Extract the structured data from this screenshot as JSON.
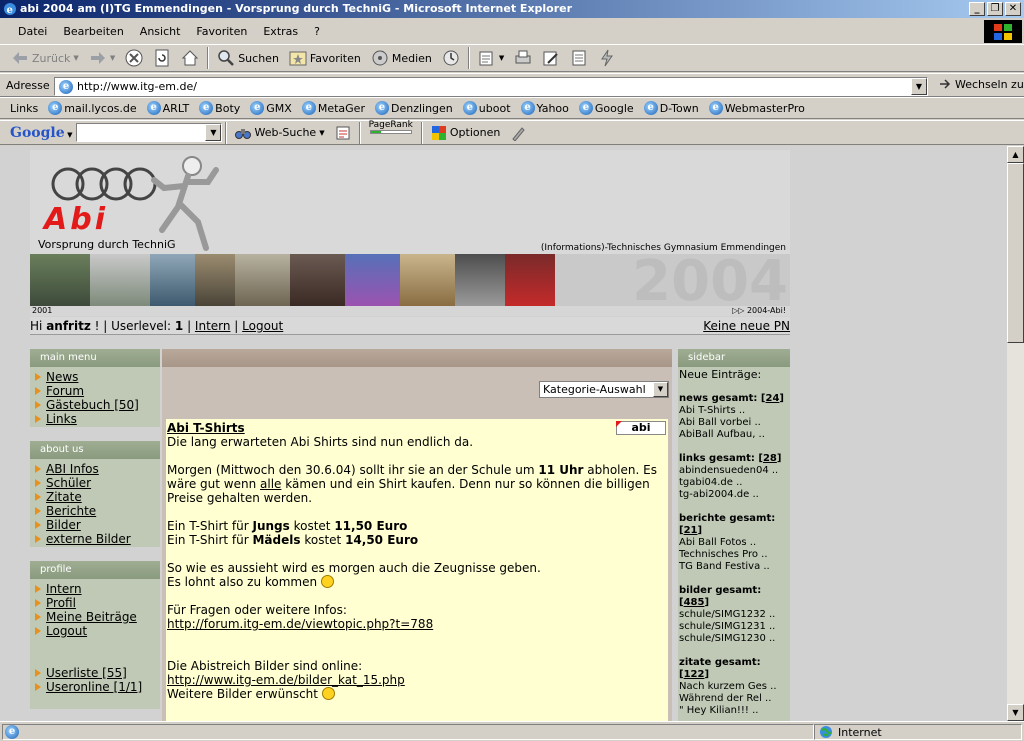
{
  "window": {
    "title": "abi 2004 am (I)TG Emmendingen - Vorsprung durch TechniG - Microsoft Internet Explorer",
    "controls": [
      "_",
      "❐",
      "✕"
    ]
  },
  "menu": [
    "Datei",
    "Bearbeiten",
    "Ansicht",
    "Favoriten",
    "Extras",
    "?"
  ],
  "toolbar": {
    "back": "Zurück",
    "search": "Suchen",
    "favorites": "Favoriten",
    "media": "Medien"
  },
  "address": {
    "label": "Adresse",
    "url": "http://www.itg-em.de/",
    "go": "Wechseln zu"
  },
  "links": {
    "label": "Links",
    "items": [
      "mail.lycos.de",
      "ARLT",
      "Boty",
      "GMX",
      "MetaGer",
      "Denzlingen",
      "uboot",
      "Yahoo",
      "Google",
      "D-Town",
      "WebmasterPro"
    ]
  },
  "googlebar": {
    "brand": "Google",
    "websearch": "Web-Suche",
    "pagerank": "PageRank",
    "options": "Optionen"
  },
  "page": {
    "banner": {
      "logo_word": "Abi",
      "slogan": "Vorsprung durch TechniG",
      "school": "(Informations)-Technisches Gymnasium Emmendingen",
      "year": "2004",
      "strip_left": "2001",
      "strip_right": "▷▷ 2004-Abi!"
    },
    "user": {
      "hi": "Hi",
      "name": "anfritz",
      "mid": "! | Userlevel:",
      "level": "1",
      "intern": "Intern",
      "logout": "Logout",
      "pn": "Keine neue PN"
    },
    "mainmenu": {
      "head": "main menu",
      "items": [
        "News",
        "Forum",
        "Gästebuch [50]",
        "Links"
      ]
    },
    "aboutus": {
      "head": "about us",
      "items": [
        "ABI Infos",
        "Schüler",
        "Zitate",
        "Berichte",
        "Bilder",
        "externe Bilder"
      ]
    },
    "profile": {
      "head": "profile",
      "items": [
        "Intern",
        "Profil",
        "Meine Beiträge",
        "Logout"
      ],
      "extra": [
        "Userliste [55]",
        "Useronline [1/1]"
      ]
    },
    "category_select": "Kategorie-Auswahl",
    "post": {
      "title": "Abi T-Shirts",
      "tag": "abi",
      "p1": "Die lang erwarteten Abi Shirts sind nun endlich da.",
      "p2a": "Morgen (Mittwoch den 30.6.04) sollt ihr sie an der Schule um ",
      "p2b": "11 Uhr",
      "p2c": " abholen. Es wäre gut wenn ",
      "p2d": "alle",
      "p2e": " kämen und ein Shirt kaufen. Denn nur so können die billigen Preise gehalten werden.",
      "p3a": "Ein T-Shirt für ",
      "p3b": "Jungs",
      "p3c": " kostet ",
      "p3d": "11,50 Euro",
      "p3e": "Ein T-Shirt für ",
      "p3f": "Mädels",
      "p3g": " kostet ",
      "p3h": "14,50 Euro",
      "p4a": "So wie es aussieht wird es morgen auch die Zeugnisse geben.",
      "p4b": "Es lohnt also zu kommen",
      "p5": "Für Fragen oder weitere Infos:",
      "link1": "http://forum.itg-em.de/viewtopic.php?t=788",
      "p6": "Die Abistreich Bilder sind online:",
      "link2": "http://www.itg-em.de/bilder_kat_15.php",
      "p7": "Weitere Bilder erwünscht"
    },
    "sidebar": {
      "head": "sidebar",
      "intro": "Neue Einträge:",
      "groups": [
        {
          "label": "news gesamt:",
          "count": "24",
          "items": [
            "Abi T-Shirts ..",
            "Abi Ball vorbei ..",
            "AbiBall Aufbau, .."
          ]
        },
        {
          "label": "links gesamt:",
          "count": "28",
          "items": [
            "abindensueden04 ..",
            "tgabi04.de ..",
            "tg-abi2004.de .."
          ]
        },
        {
          "label": "berichte gesamt:",
          "count": "21",
          "items": [
            "Abi Ball Fotos ..",
            "Technisches Pro ..",
            "TG Band Festiva .."
          ]
        },
        {
          "label": "bilder gesamt:",
          "count": "485",
          "items": [
            "schule/SIMG1232 ..",
            "schule/SIMG1231 ..",
            "schule/SIMG1230 .."
          ]
        },
        {
          "label": "zitate gesamt:",
          "count": "122",
          "items": [
            "Nach kurzem Ges ..",
            "Während der Rel ..",
            "\" Hey Kilian!!! .."
          ]
        }
      ]
    }
  },
  "status": {
    "zone": "Internet"
  }
}
